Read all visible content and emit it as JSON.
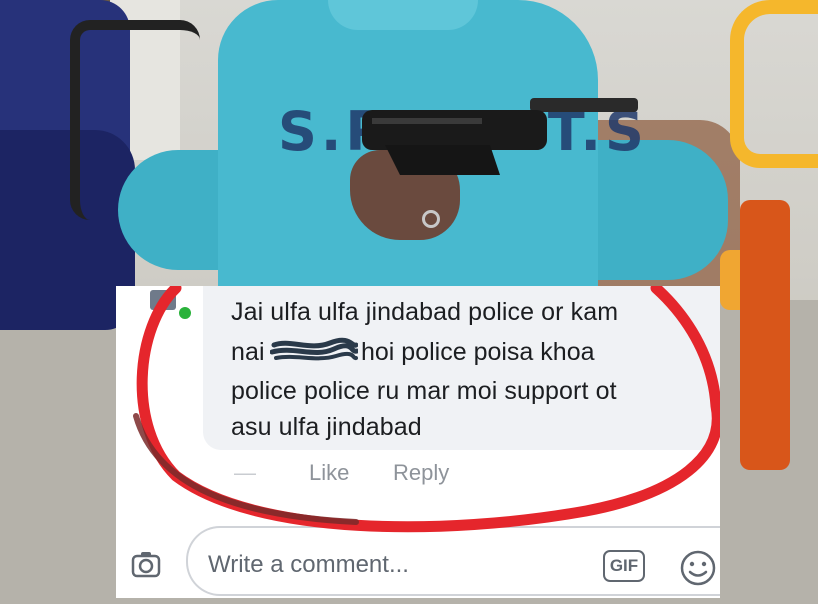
{
  "photo": {
    "sweater_print": "S.P.O.R.T.S"
  },
  "comment": {
    "lines": [
      "Jai ulfa ulfa jindabad police or kam",
      "nai",
      "hoi police poisa khoa",
      "police police ru mar moi support ot",
      "asu ulfa jindabad"
    ],
    "actions": {
      "like": "Like",
      "reply": "Reply"
    }
  },
  "composer": {
    "placeholder": "Write a comment...",
    "gif_label": "GIF"
  },
  "colors": {
    "annotation_red": "#e5262c",
    "online_green": "#2ab23b",
    "bubble_bg": "#f0f2f5",
    "sweater": "#48b9cf"
  },
  "icons": [
    "camera-icon",
    "gif-icon",
    "emoji-icon",
    "online-status-icon"
  ]
}
